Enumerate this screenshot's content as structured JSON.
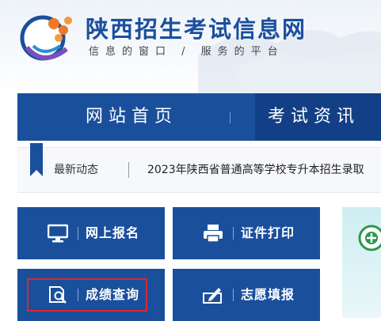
{
  "site": {
    "title": "陕西招生考试信息网",
    "slogan": "信息的窗口 / 服务的平台"
  },
  "nav": {
    "home_label": "网站首页",
    "exam_label": "考试资讯"
  },
  "news": {
    "label": "最新动态",
    "headline": "2023年陕西省普通高等学校专升本招生录取"
  },
  "quick_links": {
    "register": "网上报名",
    "print": "证件打印",
    "score": "成绩查询",
    "preference": "志愿填报"
  },
  "colors": {
    "brand_blue": "#1a4f9c",
    "highlight_red": "#d9282f",
    "logo_orange": "#f0782a"
  },
  "icons": {
    "register": "monitor-icon",
    "print": "printer-icon",
    "score": "search-document-icon",
    "preference": "pen-form-icon",
    "news": "bookmark-icon"
  }
}
